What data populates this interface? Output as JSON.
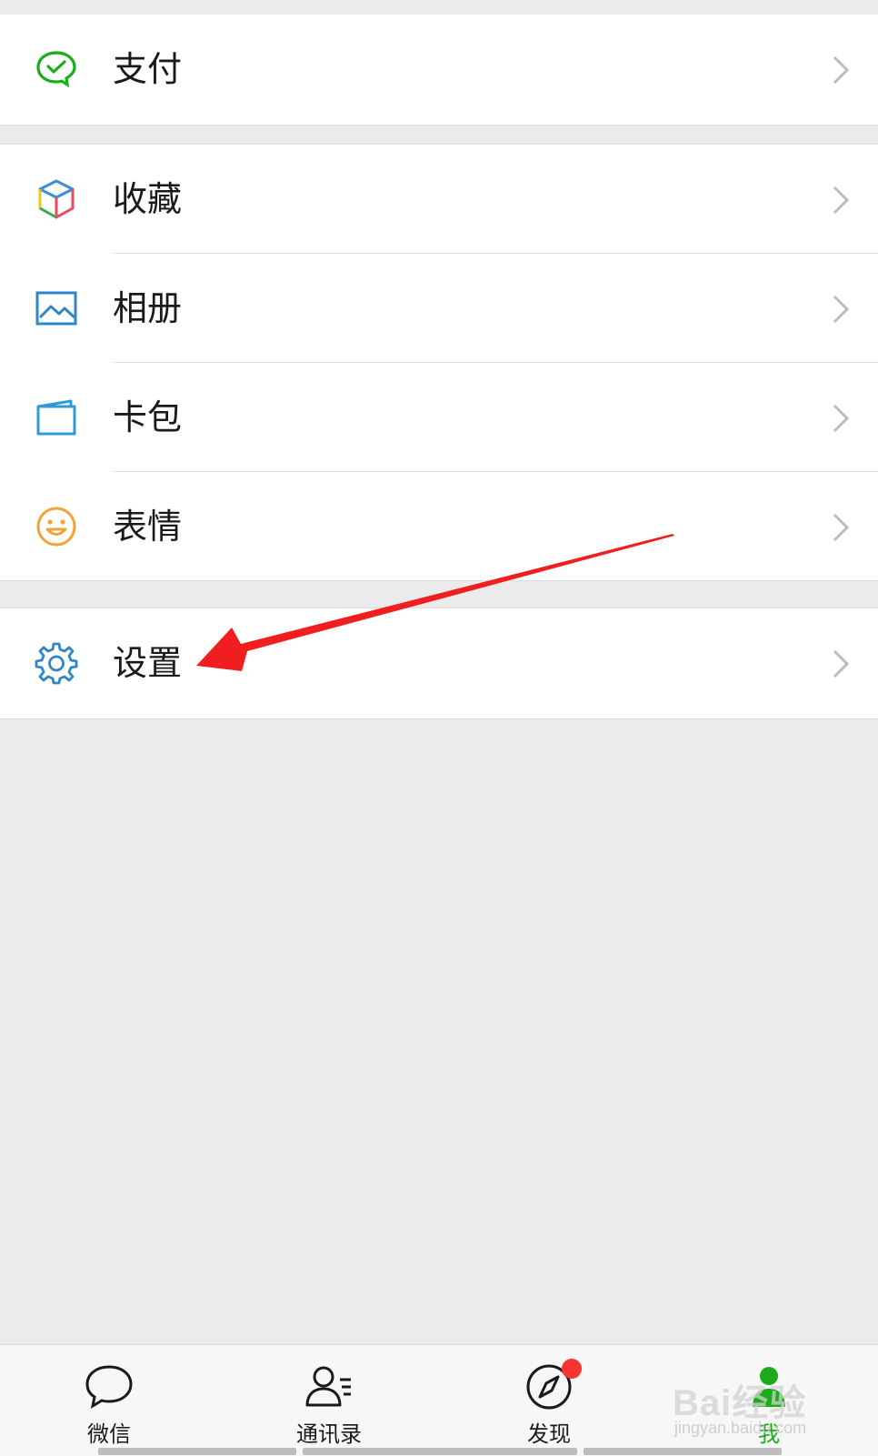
{
  "menu": {
    "pay": {
      "label": "支付",
      "icon": "wechat-pay-icon"
    },
    "items": [
      {
        "label": "收藏",
        "icon": "favorites-cube-icon"
      },
      {
        "label": "相册",
        "icon": "album-picture-icon"
      },
      {
        "label": "卡包",
        "icon": "card-wallet-icon"
      },
      {
        "label": "表情",
        "icon": "smiley-face-icon"
      }
    ],
    "settings": {
      "label": "设置",
      "icon": "gear-icon"
    }
  },
  "tabbar": {
    "tabs": [
      {
        "label": "微信",
        "icon": "chat-bubble-icon",
        "active": false
      },
      {
        "label": "通讯录",
        "icon": "contacts-icon",
        "active": false
      },
      {
        "label": "发现",
        "icon": "compass-icon",
        "active": false,
        "badge": true
      },
      {
        "label": "我",
        "icon": "me-person-icon",
        "active": true
      }
    ]
  },
  "watermark": {
    "logo": "Bai经验",
    "sub": "jingyan.baidu.com"
  },
  "colors": {
    "accent_green": "#1aad19",
    "annotation_red": "#f01e1e",
    "badge_red": "#f43530",
    "background": "#ebebeb"
  }
}
